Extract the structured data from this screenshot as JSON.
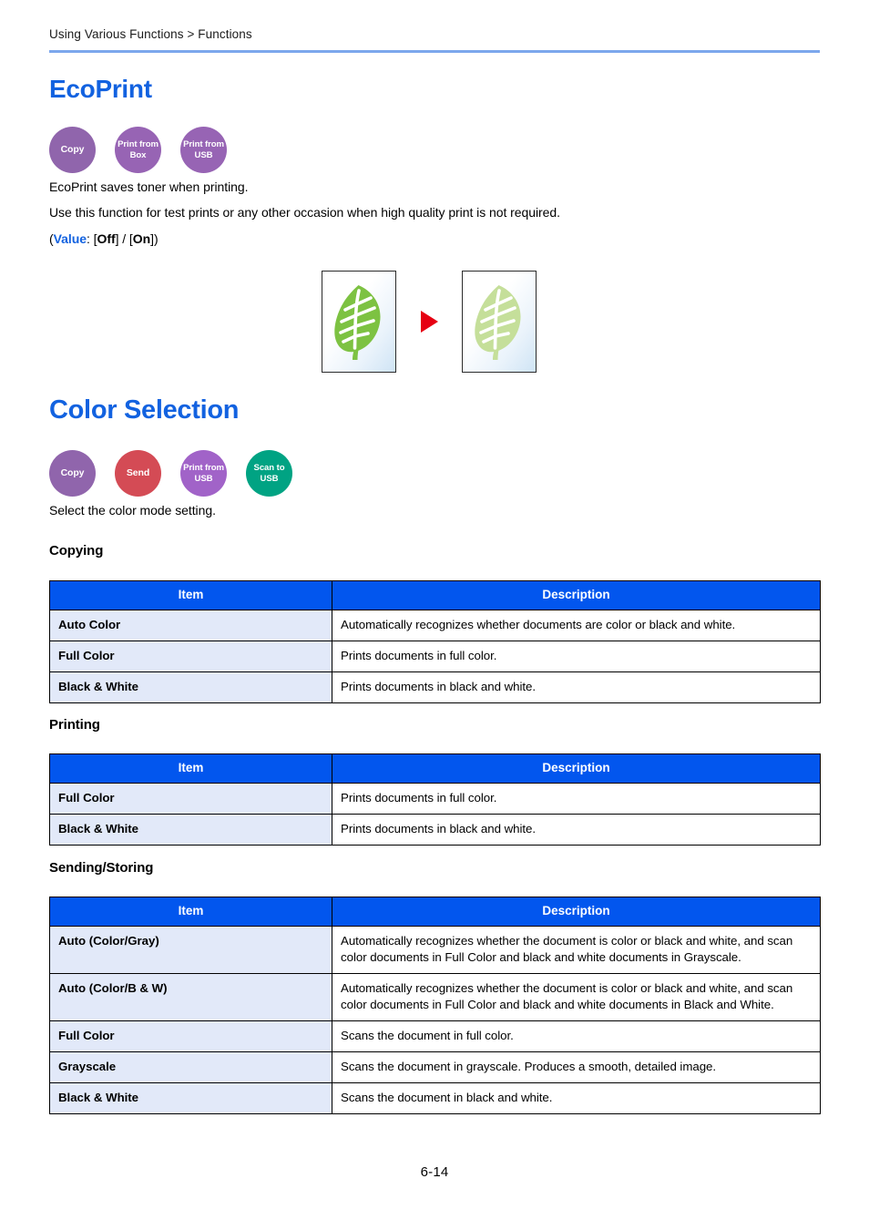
{
  "header": {
    "breadcrumb": "Using Various Functions > Functions",
    "rule_color": "#7ca7ec"
  },
  "sections": {
    "ecoprint": {
      "title": "EcoPrint",
      "title_color": "#1262e0",
      "badges": [
        {
          "name": "copy",
          "lines": [
            "Copy"
          ],
          "color": "#9065ac"
        },
        {
          "name": "print-from-box",
          "lines": [
            "Print from",
            "Box"
          ],
          "color": "#9764b4"
        },
        {
          "name": "print-from-usb",
          "lines": [
            "Print from",
            "USB"
          ],
          "color": "#9764b4"
        }
      ],
      "paragraph_1": "EcoPrint saves toner when printing.",
      "paragraph_2": "Use this function for test prints or any other occasion when high quality print is not required.",
      "value_line": {
        "open": "(",
        "key": "Value",
        "colon": ": [",
        "option_1": "Off",
        "separator": "] / [",
        "option_2": "On",
        "close": "])"
      },
      "figure": {
        "before_label": "leaf-full-color",
        "after_label": "leaf-ecoprint",
        "arrow": "play-triangle",
        "leaf_color_before": "#7dc242",
        "leaf_color_after": "#c5df9a",
        "arrow_color": "#e60012"
      }
    },
    "color_selection": {
      "title": "Color Selection",
      "title_color": "#1262e0",
      "badges": [
        {
          "name": "copy",
          "lines": [
            "Copy"
          ],
          "color": "#9065ac"
        },
        {
          "name": "send",
          "lines": [
            "Send"
          ],
          "color": "#d44b55"
        },
        {
          "name": "print-from-usb",
          "lines": [
            "Print from",
            "USB"
          ],
          "color": "#a163c8"
        },
        {
          "name": "scan-to-usb",
          "lines": [
            "Scan to",
            "USB"
          ],
          "color": "#00a383"
        }
      ],
      "paragraph_1": "Select the color mode setting.",
      "tables": [
        {
          "heading": "Copying",
          "columns": [
            "Item",
            "Description"
          ],
          "rows": [
            {
              "item": "Auto Color",
              "description": "Automatically recognizes whether documents are color or black and white."
            },
            {
              "item": "Full Color",
              "description": "Prints documents in full color."
            },
            {
              "item": "Black & White",
              "description": "Prints documents in black and white."
            }
          ]
        },
        {
          "heading": "Printing",
          "columns": [
            "Item",
            "Description"
          ],
          "rows": [
            {
              "item": "Full Color",
              "description": "Prints documents in full color."
            },
            {
              "item": "Black & White",
              "description": "Prints documents in black and white."
            }
          ]
        },
        {
          "heading": "Sending/Storing",
          "columns": [
            "Item",
            "Description"
          ],
          "rows": [
            {
              "item": "Auto (Color/Gray)",
              "description": "Automatically recognizes whether the document is color or black and white, and scan color documents in Full Color and black and white documents in Grayscale."
            },
            {
              "item": "Auto (Color/B & W)",
              "description": "Automatically recognizes whether the document is color or black and white, and scan color documents in Full Color and black and white documents in Black and White."
            },
            {
              "item": "Full Color",
              "description": "Scans the document in full color."
            },
            {
              "item": "Grayscale",
              "description": "Scans the document in grayscale. Produces a smooth, detailed image."
            },
            {
              "item": "Black & White",
              "description": "Scans the document in black and white."
            }
          ]
        }
      ]
    }
  },
  "footer": {
    "page_number": "6-14"
  }
}
